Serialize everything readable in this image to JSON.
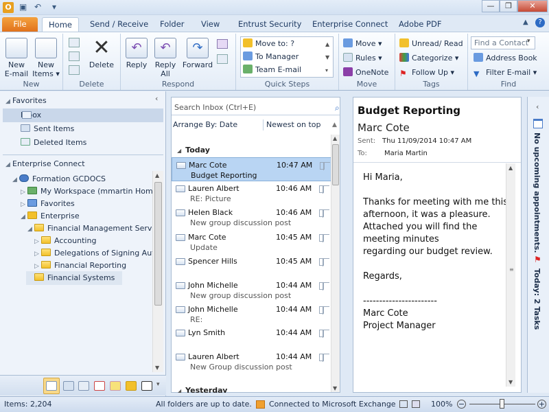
{
  "qat": {
    "undo_label": "↶",
    "dropdown": "▾"
  },
  "window": {
    "minimize": "—",
    "restore": "❐",
    "close": "✕"
  },
  "tabs": [
    {
      "label": "File"
    },
    {
      "label": "Home"
    },
    {
      "label": "Send / Receive"
    },
    {
      "label": "Folder"
    },
    {
      "label": "View"
    },
    {
      "label": "Entrust Security"
    },
    {
      "label": "Enterprise Connect"
    },
    {
      "label": "Adobe PDF"
    }
  ],
  "ribbon": {
    "new": {
      "label": "New",
      "new_email": "New\nE-mail",
      "new_email_1": "New",
      "new_email_2": "E-mail",
      "new_items_1": "New",
      "new_items_2": "Items ▾"
    },
    "delete": {
      "label": "Delete",
      "delete_btn": "Delete"
    },
    "respond": {
      "label": "Respond",
      "reply": "Reply",
      "reply_all_1": "Reply",
      "reply_all_2": "All",
      "forward": "Forward"
    },
    "quick_steps": {
      "label": "Quick Steps",
      "items": [
        "Move to: ?",
        "To Manager",
        "Team E-mail"
      ]
    },
    "move": {
      "label": "Move",
      "move": "Move ▾",
      "rules": "Rules ▾",
      "onenote": "OneNote"
    },
    "tags": {
      "label": "Tags",
      "unread_read": "Unread/ Read",
      "categorize": "Categorize ▾",
      "follow_up": "Follow Up ▾"
    },
    "find": {
      "label": "Find",
      "find_contact": "Find a Contact",
      "address_book": "Address Book",
      "filter_email": "Filter E-mail ▾"
    }
  },
  "nav": {
    "favorites_header": "Favorites",
    "favorites": [
      {
        "label": "Inbox"
      },
      {
        "label": "Sent Items"
      },
      {
        "label": "Deleted Items"
      }
    ],
    "ec_header": "Enterprise Connect",
    "tree": [
      {
        "label": "Formation GCDOCS"
      },
      {
        "label": "My Workspace (mmartin Home)"
      },
      {
        "label": "Favorites"
      },
      {
        "label": "Enterprise"
      },
      {
        "label": "Financial Management Servic"
      },
      {
        "label": "Accounting"
      },
      {
        "label": "Delegations of Signing Auth"
      },
      {
        "label": "Financial Reporting"
      },
      {
        "label": "Financial Systems"
      }
    ]
  },
  "list": {
    "search_placeholder": "Search Inbox (Ctrl+E)",
    "arrange_by": "Arrange By: Date",
    "sort_order": "Newest on top",
    "group_today": "Today",
    "group_yesterday": "Yesterday",
    "messages": [
      {
        "sender": "Marc Cote",
        "time": "10:47 AM",
        "subject": "Budget Reporting"
      },
      {
        "sender": "Lauren Albert",
        "time": "10:46 AM",
        "subject": "RE: Picture"
      },
      {
        "sender": "Helen Black",
        "time": "10:46 AM",
        "subject": "New group discussion post"
      },
      {
        "sender": "Marc Cote",
        "time": "10:45 AM",
        "subject": "Update"
      },
      {
        "sender": "Spencer Hills",
        "time": "10:45 AM",
        "subject": ""
      },
      {
        "sender": "John Michelle",
        "time": "10:44 AM",
        "subject": "New group discussion post"
      },
      {
        "sender": "John Michelle",
        "time": "10:44 AM",
        "subject": "RE:"
      },
      {
        "sender": "Lyn Smith",
        "time": "10:44 AM",
        "subject": ""
      },
      {
        "sender": "Lauren Albert",
        "time": "10:44 AM",
        "subject": "New Group discussion post"
      }
    ]
  },
  "reading": {
    "subject": "Budget Reporting",
    "from": "Marc Cote",
    "sent_label": "Sent:",
    "sent_value": "Thu 11/09/2014 10:47 AM",
    "to_label": "To:",
    "to_value": "Maria Martin",
    "body": [
      "Hi Maria,",
      "",
      "Thanks for meeting with me this",
      "afternoon, it was a pleasure.",
      "Attached you will find the",
      "meeting minutes",
      "regarding our budget review.",
      "",
      "Regards,",
      "",
      "-----------------------",
      "Marc Cote",
      "Project Manager"
    ]
  },
  "todo": {
    "appointments": "No upcoming appointments.",
    "tasks": "Today: 2 Tasks"
  },
  "status": {
    "items": "Items: 2,204",
    "sync": "All folders are up to date.",
    "exchange": "Connected to Microsoft Exchange",
    "zoom": "100%",
    "zoom_level": 1.0
  }
}
